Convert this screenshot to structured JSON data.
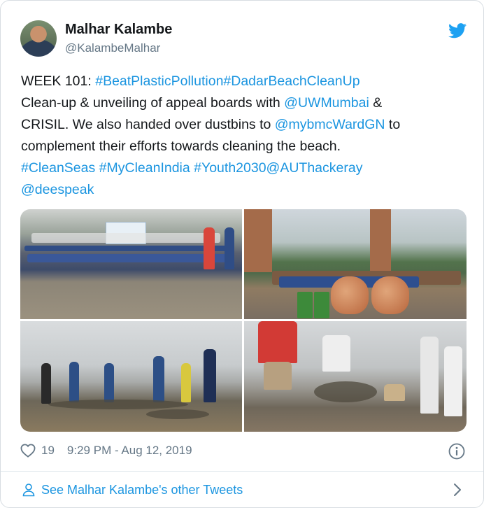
{
  "author": {
    "name": "Malhar Kalambe",
    "handle": "@KalambeMalhar",
    "avatar_icon": "profile-photo"
  },
  "brand": {
    "icon": "twitter-bird-icon",
    "color": "#1da1f2"
  },
  "tweet": {
    "line1_prefix": "WEEK 101: ",
    "line1_link": "#BeatPlasticPollution#DadarBeachCleanUp",
    "line2_prefix": "Clean-up & unveiling of appeal boards with ",
    "line2_link": "@UWMumbai",
    "line2_suffix": " &",
    "line3_prefix": "CRISIL. We also handed over dustbins to ",
    "line3_link": "@mybmcWardGN",
    "line3_suffix": " to",
    "line4": "complement their efforts towards cleaning the beach.",
    "line5_link": "#CleanSeas #MyCleanIndia #Youth2030@AUThackeray",
    "line6_link": "@deespeak"
  },
  "media": {
    "photos": [
      "group-photo-beach",
      "dustbins-handover-photo",
      "beach-cleanup-photo",
      "debris-collection-photo"
    ]
  },
  "footer": {
    "likes": "19",
    "timestamp": "9:29 PM - Aug 12, 2019",
    "heart_icon": "heart-icon",
    "info_icon": "info-icon"
  },
  "more_tweets": {
    "label": "See Malhar Kalambe's other Tweets",
    "person_icon": "person-icon",
    "chevron_icon": "chevron-right-icon"
  },
  "colors": {
    "link": "#1b95e0",
    "text": "#14171a",
    "muted": "#657786",
    "border": "#d7dde2"
  }
}
